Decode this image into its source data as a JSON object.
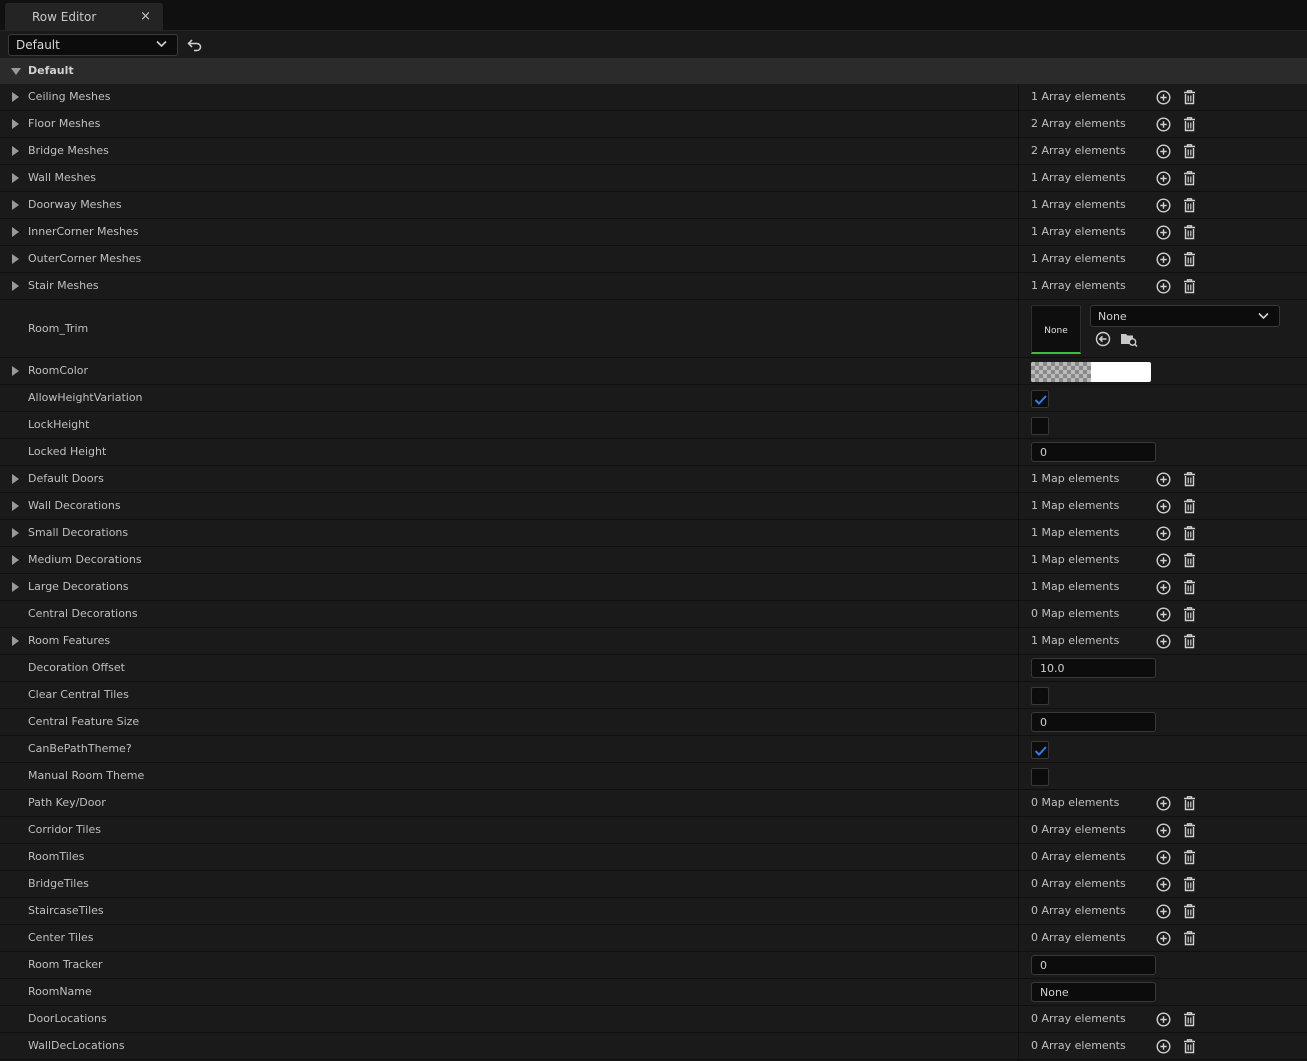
{
  "tab": {
    "title": "Row Editor",
    "close": "×"
  },
  "toolbar": {
    "row_select": "Default"
  },
  "category": {
    "title": "Default"
  },
  "rows": [
    {
      "label": "Ceiling Meshes",
      "kind": "array",
      "expandable": true,
      "value": "1 Array elements"
    },
    {
      "label": "Floor Meshes",
      "kind": "array",
      "expandable": true,
      "value": "2 Array elements"
    },
    {
      "label": "Bridge Meshes",
      "kind": "array",
      "expandable": true,
      "value": "2 Array elements"
    },
    {
      "label": "Wall Meshes",
      "kind": "array",
      "expandable": true,
      "value": "1 Array elements"
    },
    {
      "label": "Doorway Meshes",
      "kind": "array",
      "expandable": true,
      "value": "1 Array elements"
    },
    {
      "label": "InnerCorner Meshes",
      "kind": "array",
      "expandable": true,
      "value": "1 Array elements"
    },
    {
      "label": "OuterCorner Meshes",
      "kind": "array",
      "expandable": true,
      "value": "1 Array elements"
    },
    {
      "label": "Stair Meshes",
      "kind": "array",
      "expandable": true,
      "value": "1 Array elements"
    },
    {
      "label": "Room_Trim",
      "kind": "asset",
      "expandable": false,
      "thumb": "None",
      "value": "None"
    },
    {
      "label": "RoomColor",
      "kind": "color",
      "expandable": true,
      "color": "#ffffff"
    },
    {
      "label": "AllowHeightVariation",
      "kind": "check",
      "expandable": false,
      "checked": true
    },
    {
      "label": "LockHeight",
      "kind": "check",
      "expandable": false,
      "checked": false
    },
    {
      "label": "Locked Height",
      "kind": "number",
      "expandable": false,
      "value": "0"
    },
    {
      "label": "Default Doors",
      "kind": "array",
      "expandable": true,
      "value": "1 Map elements"
    },
    {
      "label": "Wall Decorations",
      "kind": "array",
      "expandable": true,
      "value": "1 Map elements"
    },
    {
      "label": "Small Decorations",
      "kind": "array",
      "expandable": true,
      "value": "1 Map elements"
    },
    {
      "label": "Medium Decorations",
      "kind": "array",
      "expandable": true,
      "value": "1 Map elements"
    },
    {
      "label": "Large Decorations",
      "kind": "array",
      "expandable": true,
      "value": "1 Map elements"
    },
    {
      "label": "Central Decorations",
      "kind": "array",
      "expandable": false,
      "value": "0 Map elements"
    },
    {
      "label": "Room Features",
      "kind": "array",
      "expandable": true,
      "value": "1 Map elements"
    },
    {
      "label": "Decoration Offset",
      "kind": "number",
      "expandable": false,
      "value": "10.0"
    },
    {
      "label": "Clear Central Tiles",
      "kind": "check",
      "expandable": false,
      "checked": false
    },
    {
      "label": "Central Feature Size",
      "kind": "number",
      "expandable": false,
      "value": "0"
    },
    {
      "label": "CanBePathTheme?",
      "kind": "check",
      "expandable": false,
      "checked": true
    },
    {
      "label": "Manual Room Theme",
      "kind": "check",
      "expandable": false,
      "checked": false
    },
    {
      "label": "Path Key/Door",
      "kind": "array",
      "expandable": false,
      "value": "0 Map elements"
    },
    {
      "label": "Corridor Tiles",
      "kind": "array",
      "expandable": false,
      "value": "0 Array elements"
    },
    {
      "label": "RoomTiles",
      "kind": "array",
      "expandable": false,
      "value": "0 Array elements"
    },
    {
      "label": "BridgeTiles",
      "kind": "array",
      "expandable": false,
      "value": "0 Array elements"
    },
    {
      "label": "StaircaseTiles",
      "kind": "array",
      "expandable": false,
      "value": "0 Array elements"
    },
    {
      "label": "Center Tiles",
      "kind": "array",
      "expandable": false,
      "value": "0 Array elements"
    },
    {
      "label": "Room Tracker",
      "kind": "number",
      "expandable": false,
      "value": "0"
    },
    {
      "label": "RoomName",
      "kind": "number",
      "expandable": false,
      "value": "None"
    },
    {
      "label": "DoorLocations",
      "kind": "array",
      "expandable": false,
      "value": "0 Array elements"
    },
    {
      "label": "WallDecLocations",
      "kind": "array",
      "expandable": false,
      "value": "0 Array elements"
    }
  ],
  "icons": {
    "add": "plus-circle-icon",
    "delete": "trash-icon",
    "expand": "triangle-right-icon",
    "revert": "undo-arrow-icon",
    "check_color": "#2d7ce0"
  }
}
